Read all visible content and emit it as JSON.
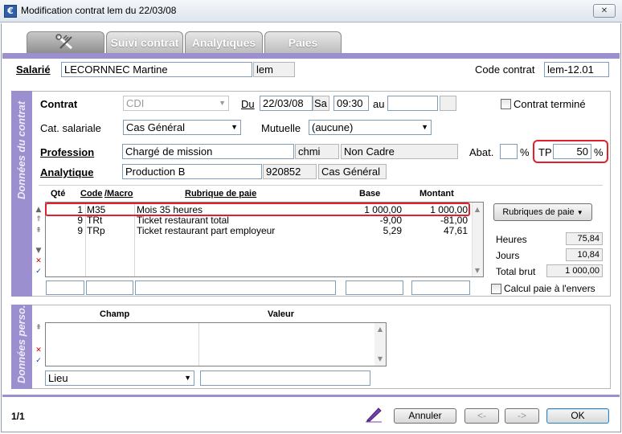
{
  "window": {
    "title": "Modification contrat lem du 22/03/08",
    "close_glyph": "✕"
  },
  "tabs": [
    {
      "label": "",
      "icon": "wrench-tools-icon",
      "active": true
    },
    {
      "label": "Suivi contrat"
    },
    {
      "label": "Analytiques"
    },
    {
      "label": "Paies"
    }
  ],
  "employee": {
    "label": "Salarié",
    "name": "LECORNNEC Martine",
    "code": "lem",
    "contract_code_label": "Code contrat",
    "contract_code": "lem-12.01"
  },
  "section_contract": {
    "side_label": "Données du contrat",
    "contrat_label": "Contrat",
    "contrat_value": "CDI",
    "du_label": "Du",
    "du_date": "22/03/08",
    "du_day": "Sa",
    "du_time": "09:30",
    "au_label": "au",
    "au_date": "",
    "au_day": "",
    "termine_label": "Contrat terminé",
    "cat_label": "Cat. salariale",
    "cat_value": "Cas Général",
    "mutuelle_label": "Mutuelle",
    "mutuelle_value": "(aucune)",
    "profession_label": "Profession",
    "profession_value": "Chargé de mission",
    "profession_code": "chmi",
    "profession_status": "Non Cadre",
    "abat_label": "Abat.",
    "abat_value": "",
    "percent": "%",
    "tp_label": "TP",
    "tp_value": "50",
    "analytique_label": "Analytique",
    "analytique_value": "Production B",
    "analytique_code": "920852",
    "analytique_cat": "Cas Général"
  },
  "pay_table": {
    "headers": {
      "qte": "Qté",
      "code": "Code",
      "macro": "/Macro",
      "rubrique": "Rubrique de paie",
      "base": "Base",
      "montant": "Montant"
    },
    "rows": [
      {
        "qte": "1",
        "code": "M35",
        "rubrique": "Mois 35 heures",
        "base": "1 000,00",
        "montant": "1 000,00"
      },
      {
        "qte": "9",
        "code": "TRt",
        "rubrique": "Ticket restaurant total",
        "base": "-9,00",
        "montant": "-81,00"
      },
      {
        "qte": "9",
        "code": "TRp",
        "rubrique": "Ticket restaurant part employeur",
        "base": "5,29",
        "montant": "47,61"
      }
    ],
    "rubriques_button": "Rubriques de paie",
    "heures_label": "Heures",
    "heures_value": "75,84",
    "jours_label": "Jours",
    "jours_value": "10,84",
    "total_label": "Total brut",
    "total_value": "1 000,00",
    "calcul_label": "Calcul paie à l'envers"
  },
  "section_perso": {
    "side_label": "Données perso.",
    "col_champ": "Champ",
    "col_valeur": "Valeur",
    "lieu_value": "Lieu",
    "lieu_input": ""
  },
  "footer": {
    "page_indicator": "1/1",
    "annuler": "Annuler",
    "prev": "<-",
    "next": "->",
    "ok": "OK"
  },
  "colors": {
    "accent_band": "#9b8fd0",
    "highlight": "#e0212b"
  }
}
